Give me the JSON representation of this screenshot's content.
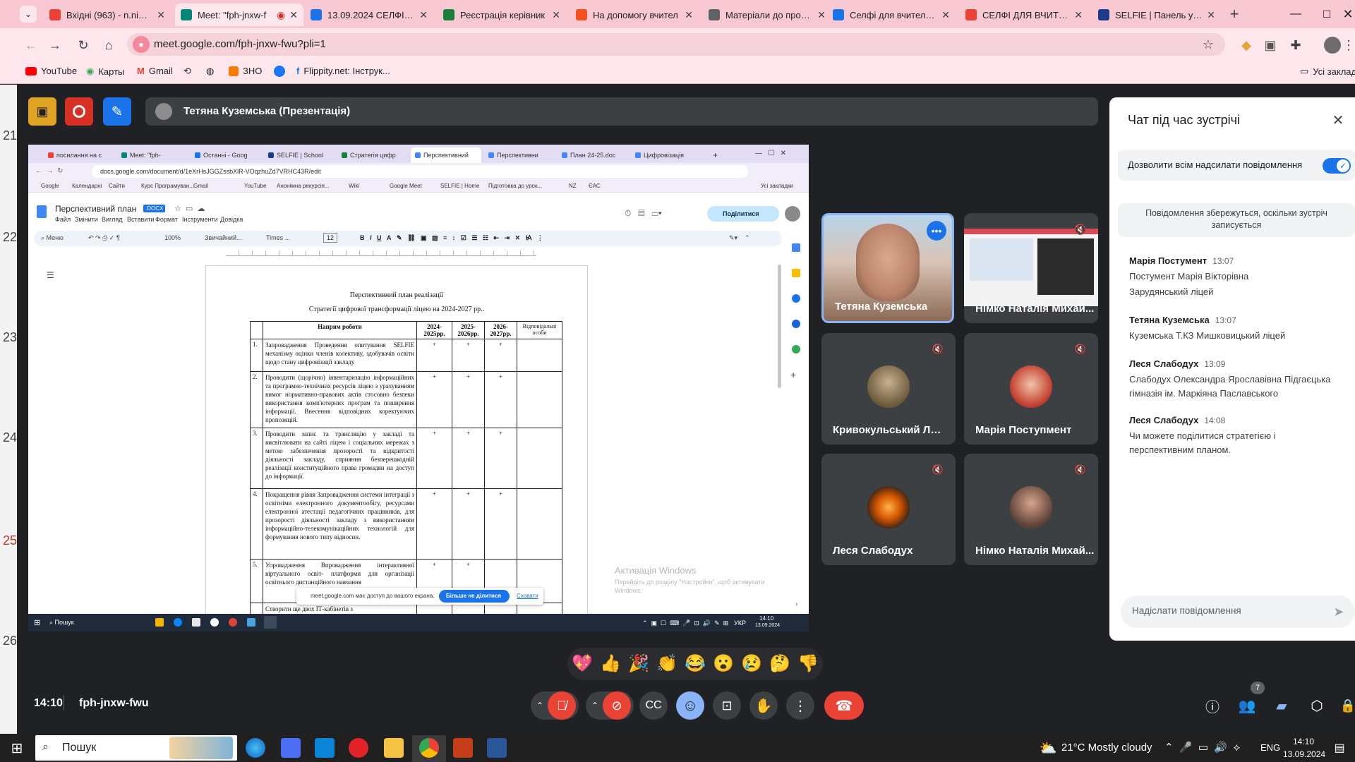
{
  "browser": {
    "tabs": [
      {
        "title": "Вхідні (963) - n.nimko",
        "color": "#ea4335",
        "active": false
      },
      {
        "title": "Meet: \"fph-jnxw-f",
        "color": "#00897b",
        "active": true
      },
      {
        "title": "13.09.2024 СЕЛФІ - G",
        "color": "#1a73e8",
        "active": false
      },
      {
        "title": "Реєстрація керівник",
        "color": "#188038",
        "active": false
      },
      {
        "title": "На допомогу вчител",
        "color": "#f4511e",
        "active": false
      },
      {
        "title": "Матеріали до проєкт",
        "color": "#5f6368",
        "active": false
      },
      {
        "title": "Селфі для вчителя –",
        "color": "#1a73e8",
        "active": false
      },
      {
        "title": "СЕЛФІ ДЛЯ ВЧИТЕЛЯ",
        "color": "#ea4335",
        "active": false
      },
      {
        "title": "SELFIE | Панель упра",
        "color": "#1e3a8a",
        "active": false
      }
    ],
    "url": "meet.google.com/fph-jnxw-fwu?pli=1",
    "bookmarks": [
      "YouTube",
      "Карты",
      "Gmail",
      "ЗНО",
      "Flippity.net: Інструк..."
    ],
    "all_bookmarks": "Усі заклад"
  },
  "presentation": {
    "presenter_label": "Тетяна Куземська (Презентація)"
  },
  "shared_screen": {
    "tabs": [
      "посилання на с",
      "Meet: \"fph-",
      "Останні - Goog",
      "SELFIE | School",
      "Стратегія цифр",
      "Перспективний",
      "Перспективни",
      "План 24-25.doc",
      "Цифровізація"
    ],
    "url": "docs.google.com/document/d/1eXrHsJGGZssbXlR-VOqzhuZd7VRHC43R/edit",
    "bookmarks": [
      "Google",
      "Календарні",
      "Сайти",
      "Курс Програмуван...",
      "Gmail",
      "YouTube",
      "Анонімна рекурсія...",
      "Wiki",
      "Google Meet",
      "SELFIE | Home",
      "Підготовка до урок...",
      "NZ",
      "ЄАС"
    ],
    "all_bookmarks": "Усі закладки",
    "doc_title": "Перспективний план",
    "doc_badge": ".DOCX",
    "menu": [
      "Файл",
      "Змінити",
      "Вигляд",
      "Вставити",
      "Формат",
      "Інструменти",
      "Довідка"
    ],
    "share_label": "Поділитися",
    "menu_search": "Меню",
    "zoom": "100%",
    "style": "Звичайний...",
    "font": "Times ...",
    "font_size": "12",
    "heading1": "Перспективний план реалізації",
    "heading2": "Стратегії цифрової трансформації ліцею на 2024-2027 рр..",
    "col_headers": [
      "",
      "Напрям роботи",
      "2024-2025рр.",
      "2025-2026рр.",
      "2026-2027рр.",
      "Відповідальні особи"
    ],
    "rows": [
      {
        "num": "1.",
        "text": "Запровадження Проведення опитування SELFIE механізму оцінки членів колективу, здобувачів освіти щодо стану цифровізації закладу",
        "c1": "+",
        "c2": "+",
        "c3": "+"
      },
      {
        "num": "2.",
        "text": "Проводити (щорічно) інвентаризацію інформаційних та програмно-технічних ресурсів ліцею з урахуванням вимог нормативно-правових актів стосовно безпеки використання комп'ютерних програм та поширення інформації. Внесення відповідних коректуючих пропозицій.",
        "c1": "+",
        "c2": "+",
        "c3": "+"
      },
      {
        "num": "3.",
        "text": "Проводити запис та трансляцію у закладі та висвітлювати на сайті ліцею і соціальних мережах з метою забезпечення прозорості та відкритості діяльності закладу, сприяння безперешкодній реалізації конституційного права громадян на доступ до інформації.",
        "c1": "+",
        "c2": "+",
        "c3": "+"
      },
      {
        "num": "4.",
        "text": "Покращення рівня Запровадження системи інтеграції з освітніми електронного документообігу, ресурсами електронної атестації педагогічних працівників, для прозорості діяльності закладу з використанням інформаційно-телекомунікаційних технологій для формування нового типу відносин.",
        "c1": "+",
        "c2": "+",
        "c3": "+"
      },
      {
        "num": "5.",
        "text": "Упровадження Впровадження інтерактивної віртуального освіт- платформи для організації освітнього дистанційного навчання",
        "c1": "+",
        "c2": "+",
        "c3": ""
      }
    ],
    "row6_partial": "Створити ще двох ІТ-кабінетів з",
    "activation_title": "Активація Windows",
    "activation_text": "Перейдіть до розділу \"Настройки\", щоб активувати Windows.",
    "share_notice": "meet.google.com має доступ до вашого екрана.",
    "stop_sharing": "Більше не ділитися",
    "hide": "Сховати",
    "taskbar_search": "Пошук",
    "taskbar_lang": "УКР",
    "taskbar_time": "14:10",
    "taskbar_date": "13.09.2024"
  },
  "participants": [
    {
      "name": "Тетяна Куземська",
      "muted": false,
      "video": true,
      "active_speaker": true
    },
    {
      "name": "Німко Наталія Михай...",
      "muted": true,
      "video": true,
      "screen": true
    },
    {
      "name": "Кривокульський Люб...",
      "muted": true,
      "avatar_color": "#6b5a3a"
    },
    {
      "name": "Марія Поступмент",
      "muted": true,
      "avatar_color": "#c0392b"
    },
    {
      "name": "Леся Слабодух",
      "muted": true,
      "avatar_color": "#d35400"
    },
    {
      "name": "Німко Наталія Михай...",
      "muted": true,
      "avatar_color": "#5d4037"
    }
  ],
  "chat": {
    "title": "Чат під час зустрічі",
    "allow_label": "Дозволити всім надсилати повідомлення",
    "allow_on": true,
    "saved_notice": "Повідомлення збережуться, оскільки зустріч записується",
    "messages": [
      {
        "sender": "Марія Постумент",
        "time": "13:07",
        "lines": [
          "Постумент Марія Вікторівна",
          "Зарудянський ліцей"
        ]
      },
      {
        "sender": "Тетяна Куземська",
        "time": "13:07",
        "lines": [
          "Куземська Т.КЗ Мишковицький ліцей"
        ]
      },
      {
        "sender": "Леся Слабодух",
        "time": "13:09",
        "lines": [
          "Слабодух Олександра Ярославівна Підгаєцька гімназія ім. Маркіяна Паславського"
        ]
      },
      {
        "sender": "Леся Слабодух",
        "time": "14:08",
        "lines": [
          "Чи можете поділитися стратегією і перспективним планом."
        ]
      }
    ],
    "input_placeholder": "Надіслати повідомлення"
  },
  "reactions": [
    "💖",
    "👍",
    "🎉",
    "👏",
    "😂",
    "😮",
    "😢",
    "🤔",
    "👎"
  ],
  "meeting": {
    "time": "14:10",
    "code": "fph-jnxw-fwu",
    "people_count": "7"
  },
  "gutter_numbers": [
    "21",
    "22",
    "23",
    "24",
    "25",
    "26"
  ],
  "taskbar": {
    "search": "Пошук",
    "weather": "21°C  Mostly cloudy",
    "lang": "ENG",
    "time": "14:10",
    "date": "13.09.2024"
  }
}
